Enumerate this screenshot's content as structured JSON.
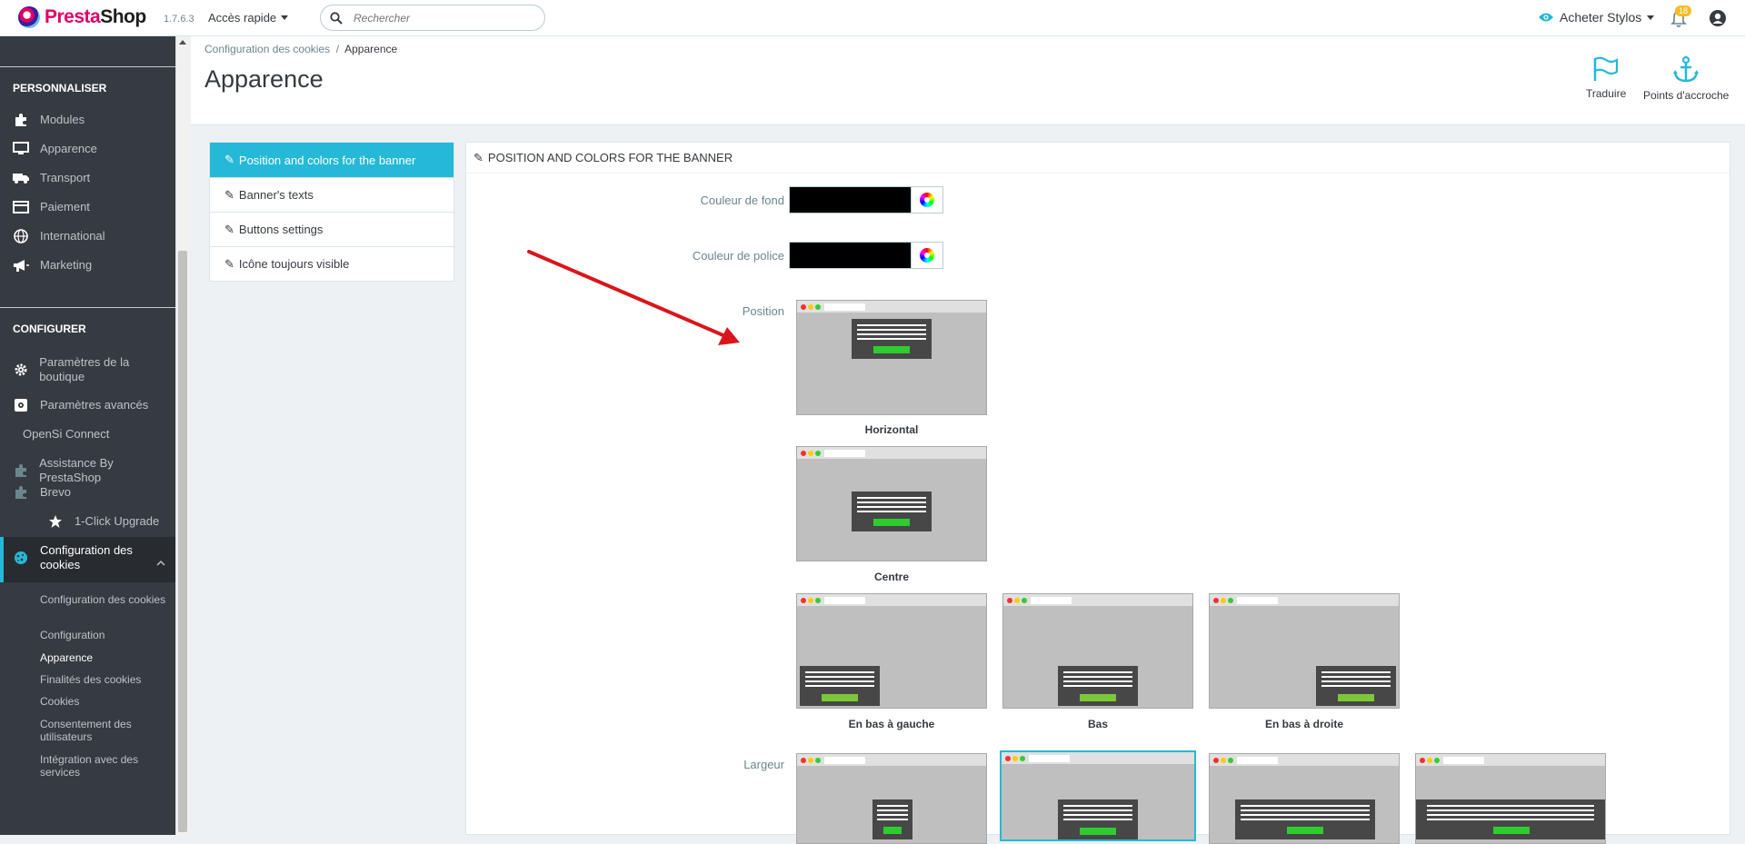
{
  "topbar": {
    "logo_text_presta": "Presta",
    "logo_text_shop": "Shop",
    "version": "1.7.6.3",
    "quick_access": "Accès rapide",
    "search_placeholder": "Rechercher",
    "shop_name": "Acheter Stylos",
    "notifications_count": "18"
  },
  "sidebar": {
    "section_personnaliser": "PERSONNALISER",
    "section_configurer": "CONFIGURER",
    "items": [
      {
        "label": "Modules",
        "icon": "puzzle-icon"
      },
      {
        "label": "Apparence",
        "icon": "monitor-icon"
      },
      {
        "label": "Transport",
        "icon": "truck-icon"
      },
      {
        "label": "Paiement",
        "icon": "card-icon"
      },
      {
        "label": "International",
        "icon": "globe-icon"
      },
      {
        "label": "Marketing",
        "icon": "megaphone-icon"
      }
    ],
    "config_items": [
      {
        "label": "Paramètres de la boutique",
        "icon": "gear-icon"
      },
      {
        "label": "Paramètres avancés",
        "icon": "settings-box-icon"
      },
      {
        "label": "OpenSi Connect",
        "icon": ""
      },
      {
        "label": "Assistance By PrestaShop",
        "icon": "puzzle-icon"
      },
      {
        "label": "Brevo",
        "icon": "puzzle-icon"
      },
      {
        "label": "1-Click Upgrade",
        "icon": "star-icon"
      }
    ],
    "active_item": "Configuration des cookies",
    "sub_items": [
      "Configuration des cookies",
      "Configuration",
      "Apparence",
      "Finalités des cookies",
      "Cookies",
      "Consentement des utilisateurs",
      "Intégration avec des services"
    ]
  },
  "header": {
    "breadcrumb_parent": "Configuration des cookies",
    "breadcrumb_sep": "/",
    "breadcrumb_current": "Apparence",
    "title": "Apparence",
    "translate_label": "Traduire",
    "hooks_label": "Points d'accroche"
  },
  "tabs": [
    "Position and colors for the banner",
    "Banner's texts",
    "Buttons settings",
    "Icône toujours visible"
  ],
  "panel": {
    "title": "POSITION AND COLORS FOR THE BANNER",
    "bg_color_label": "Couleur de fond",
    "bg_color_value": "#000000",
    "font_color_label": "Couleur de police",
    "font_color_value": "#000000",
    "position_label": "Position",
    "width_label": "Largeur",
    "positions": [
      "Horizontal",
      "Centre",
      "En bas à gauche",
      "Bas",
      "En bas à droite"
    ]
  },
  "colors": {
    "accent": "#25b9d7",
    "sidebar_bg": "#363a41",
    "arrow": "#d9161b"
  }
}
